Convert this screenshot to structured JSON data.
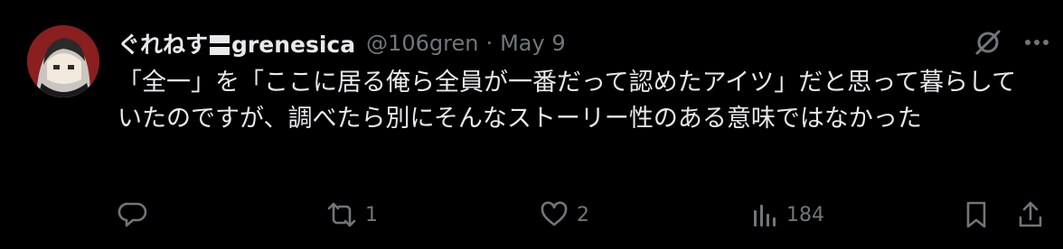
{
  "tweet": {
    "display_name": "ぐれねす",
    "display_name_suffix": "grenesica",
    "handle": "@106gren",
    "separator": "·",
    "date": "May 9",
    "body": "「全一」を「ここに居る俺ら全員が一番だって認めたアイツ」だと思って暮らしていたのですが、調べたら別にそんなストーリー性のある意味ではなかった"
  },
  "actions": {
    "reply_count": "",
    "repost_count": "1",
    "like_count": "2",
    "view_count": "184"
  },
  "icons": {
    "grok": "grok-icon",
    "more": "more-icon",
    "reply": "reply-icon",
    "repost": "repost-icon",
    "like": "heart-icon",
    "views": "views-icon",
    "bookmark": "bookmark-icon",
    "share": "share-icon"
  },
  "colors": {
    "background": "#000000",
    "text_primary": "#e7e9ea",
    "text_secondary": "#71767b"
  }
}
